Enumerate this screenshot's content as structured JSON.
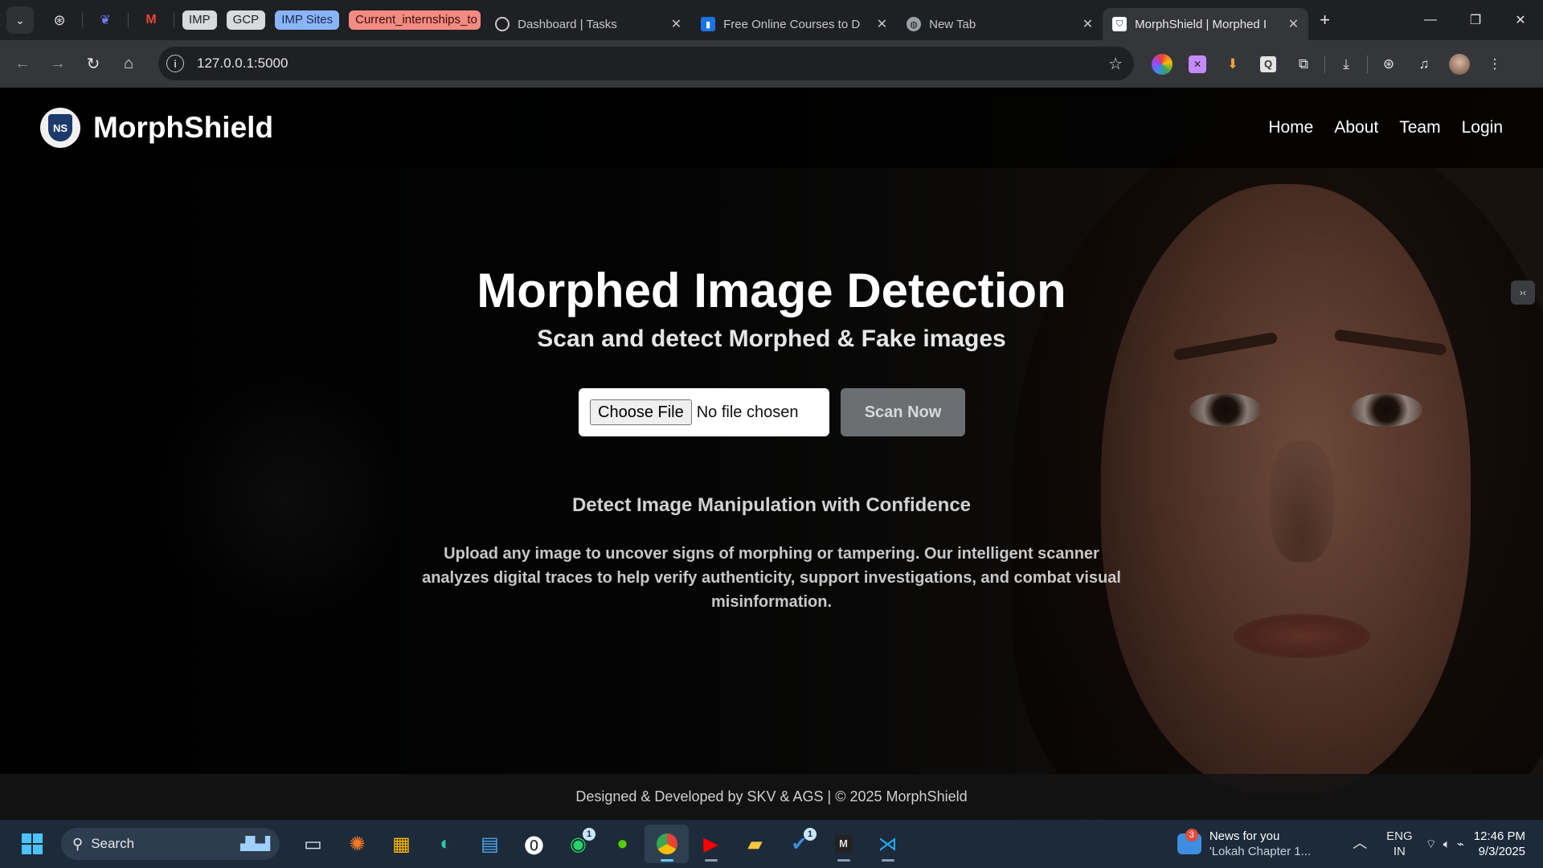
{
  "browser": {
    "pinned_groups": [
      "IMP",
      "GCP",
      "IMP Sites",
      "Current_internships_to"
    ],
    "tabs": [
      {
        "title": "Dashboard | Tasks",
        "icon": "openai-icon"
      },
      {
        "title": "Free Online Courses to D",
        "icon": "course-icon"
      },
      {
        "title": "New Tab",
        "icon": "globe-icon"
      },
      {
        "title": "MorphShield | Morphed I",
        "icon": "shield-icon",
        "active": true
      }
    ],
    "url": "127.0.0.1:5000"
  },
  "site": {
    "brand": "MorphShield",
    "logo_text": "NS",
    "nav": [
      "Home",
      "About",
      "Team",
      "Login"
    ],
    "hero_title": "Morphed Image Detection",
    "hero_subtitle": "Scan and detect Morphed & Fake images",
    "choose_file_label": "Choose File",
    "file_status": "No file chosen",
    "scan_button": "Scan Now",
    "tagline": "Detect Image Manipulation with Confidence",
    "description": "Upload any image to uncover signs of morphing or tampering. Our intelligent scanner analyzes digital traces to help verify authenticity, support investigations, and combat visual misinformation.",
    "footer": "Designed & Developed by SKV & AGS | © 2025 MorphShield"
  },
  "taskbar": {
    "search_placeholder": "Search",
    "news_title": "News for you",
    "news_sub": "'Lokah Chapter 1...",
    "news_count": "3",
    "lang": "ENG",
    "region": "IN",
    "time": "12:46 PM",
    "date": "9/3/2025",
    "whatsapp_badge": "1",
    "todo_badge": "1"
  },
  "colors": {
    "accent": "#4cc2ff",
    "scan_button": "#6c6f72",
    "brand_shield": "#1c3a6b"
  }
}
